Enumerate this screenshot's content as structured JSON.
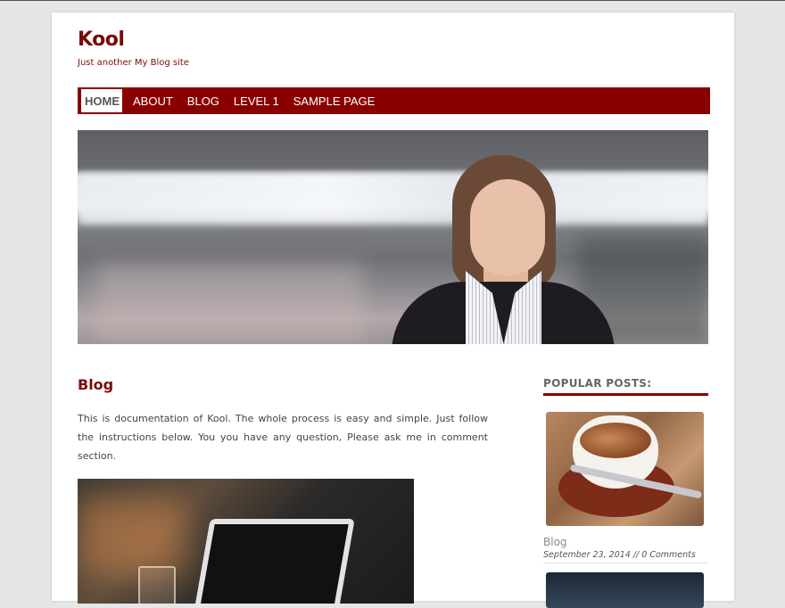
{
  "site": {
    "title": "Kool",
    "tagline": "Just another My Blog site"
  },
  "nav": {
    "items": [
      {
        "label": "HOME",
        "active": true
      },
      {
        "label": "ABOUT",
        "active": false
      },
      {
        "label": "BLOG",
        "active": false
      },
      {
        "label": "LEVEL 1",
        "active": false
      },
      {
        "label": "SAMPLE PAGE",
        "active": false
      }
    ]
  },
  "post": {
    "title": "Blog",
    "body": "This is documentation of Kool.  The whole process is easy and simple. Just follow the instructions below. You you have any question, Please ask me in comment section."
  },
  "sidebar": {
    "heading": "POPULAR POSTS:",
    "popular": [
      {
        "title": "Blog",
        "meta": "September 23, 2014 // 0 Comments"
      }
    ]
  },
  "colors": {
    "brand": "#8a0000",
    "title": "#7a0a0a",
    "background": "#e6e6e6"
  }
}
